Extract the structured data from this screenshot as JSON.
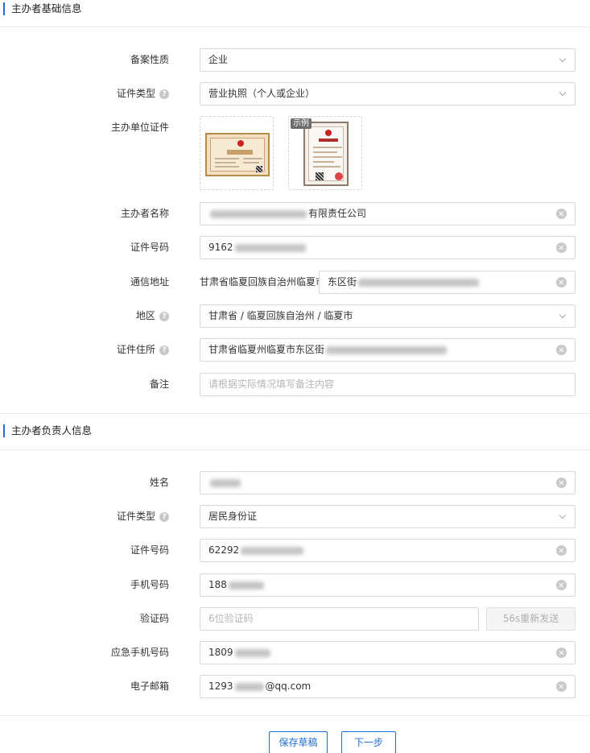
{
  "sections": {
    "basic": "主办者基础信息",
    "owner": "主办者负责人信息"
  },
  "basic": {
    "record_type": {
      "label": "备案性质",
      "value": "企业"
    },
    "cert_type": {
      "label": "证件类型",
      "value": "营业执照（个人或企业）"
    },
    "cert_upload": {
      "label": "主办单位证件",
      "sample_badge": "示例"
    },
    "name": {
      "label": "主办者名称",
      "value": "有限责任公司"
    },
    "cert_number": {
      "label": "证件号码",
      "value": "9162"
    },
    "address": {
      "label": "通信地址",
      "prefix": "甘肃省临夏回族自治州临夏市",
      "value": "东区街"
    },
    "region": {
      "label": "地区",
      "value": "甘肃省 / 临夏回族自治州 / 临夏市"
    },
    "cert_address": {
      "label": "证件住所",
      "value": "甘肃省临夏州临夏市东区街"
    },
    "remark": {
      "label": "备注",
      "placeholder": "请根据实际情况填写备注内容"
    }
  },
  "owner": {
    "name": {
      "label": "姓名",
      "value": ""
    },
    "cert_type": {
      "label": "证件类型",
      "value": "居民身份证"
    },
    "cert_number": {
      "label": "证件号码",
      "value": "62292"
    },
    "phone": {
      "label": "手机号码",
      "value": "188"
    },
    "code": {
      "label": "验证码",
      "placeholder": "6位验证码",
      "send_label": "56s重新发送"
    },
    "emergency_phone": {
      "label": "应急手机号码",
      "value": "1809"
    },
    "email": {
      "label": "电子邮箱",
      "value_prefix": "1293",
      "value_suffix": "@qq.com"
    }
  },
  "actions": {
    "save_draft": "保存草稿",
    "next": "下一步"
  },
  "colors": {
    "accent": "#1f6fd8",
    "border": "#d9d9d9"
  },
  "icons": {
    "help": "help-circle-icon",
    "clear": "clear-circle-icon",
    "dropdown": "chevron-down-icon"
  }
}
